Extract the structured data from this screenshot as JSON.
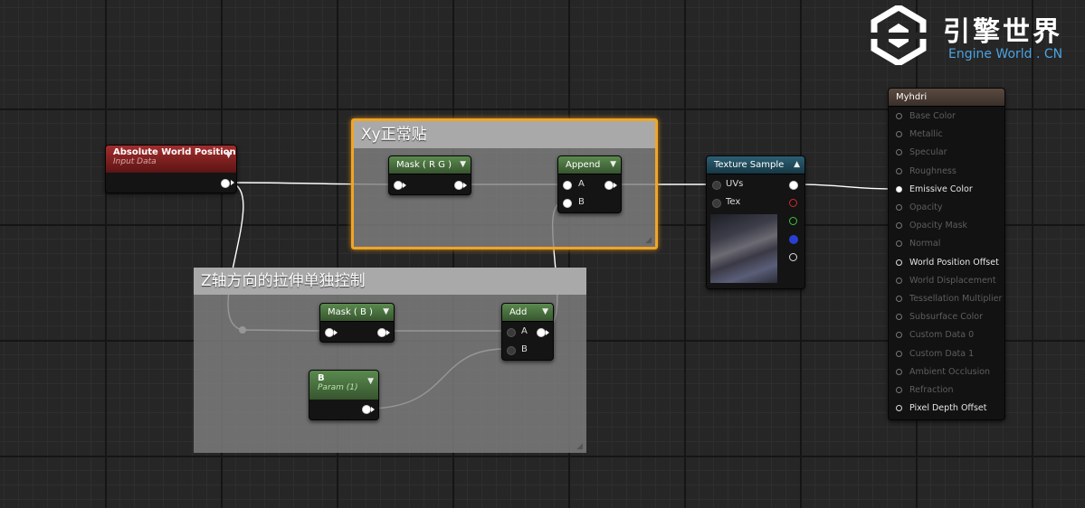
{
  "logo": {
    "cn": "引擎世界",
    "en": "Engine World . CN"
  },
  "comments": {
    "xy": "Xy正常贴",
    "z": "Z轴方向的拉伸单独控制"
  },
  "nodes": {
    "abs_pos": {
      "title": "Absolute World Position",
      "subtitle": "Input Data"
    },
    "mask_rg": {
      "title": "Mask ( R G )"
    },
    "append": {
      "title": "Append",
      "pin_a": "A",
      "pin_b": "B"
    },
    "mask_b": {
      "title": "Mask ( B )"
    },
    "add": {
      "title": "Add",
      "pin_a": "A",
      "pin_b": "B"
    },
    "param_b": {
      "title": "B",
      "subtitle": "Param (1)"
    },
    "texture_sample": {
      "title": "Texture Sample",
      "pin_uvs": "UVs",
      "pin_tex": "Tex"
    }
  },
  "material": {
    "title": "Myhdri",
    "inputs": [
      "Base Color",
      "Metallic",
      "Specular",
      "Roughness",
      "Emissive Color",
      "Opacity",
      "Opacity Mask",
      "Normal",
      "World Position Offset",
      "World Displacement",
      "Tessellation Multiplier",
      "Subsurface Color",
      "Custom Data 0",
      "Custom Data 1",
      "Ambient Occlusion",
      "Refraction",
      "Pixel Depth Offset"
    ],
    "active": [
      "Emissive Color",
      "World Position Offset",
      "Pixel Depth Offset"
    ]
  },
  "colors": {
    "accent": "#f0a526",
    "wire": "#ffffff",
    "red_pin": "#d12a2a",
    "green_pin": "#3cc43c",
    "blue_pin": "#2a3fd1"
  }
}
